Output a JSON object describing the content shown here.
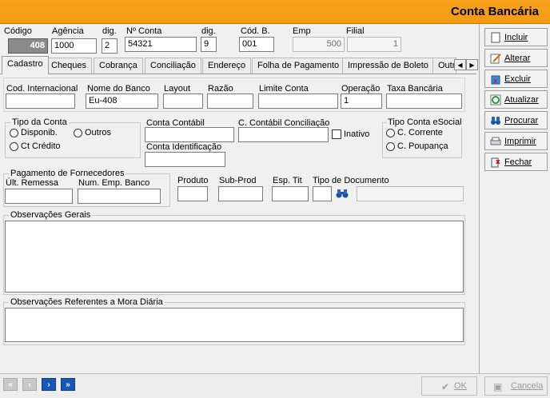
{
  "window": {
    "title": "Conta Bancária"
  },
  "header": {
    "codigo_label": "Código",
    "codigo_value": "408",
    "agencia_label": "Agência",
    "agencia_value": "1000",
    "dig1_label": "dig.",
    "dig1_value": "2",
    "conta_label": "Nº Conta",
    "conta_value": "54321",
    "dig2_label": "dig.",
    "dig2_value": "9",
    "codb_label": "Cód. B.",
    "codb_value": "001",
    "emp_label": "Emp",
    "emp_value": "500",
    "filial_label": "Filial",
    "filial_value": "1"
  },
  "tabs": [
    "Cadastro",
    "Cheques",
    "Cobrança",
    "Conciliação",
    "Endereço",
    "Folha de Pagamento",
    "Impressão de Boleto",
    "Outr"
  ],
  "cadastro": {
    "cod_intl_label": "Cod. Internacional",
    "cod_intl_value": "",
    "nome_banco_label": "Nome do Banco",
    "nome_banco_value": "Eu-408",
    "layout_label": "Layout",
    "layout_value": "",
    "razao_label": "Razão",
    "razao_value": "",
    "limite_label": "Limite Conta",
    "limite_value": "",
    "operacao_label": "Operação",
    "operacao_value": "1",
    "taxa_label": "Taxa Bancária",
    "taxa_value": ""
  },
  "tipo_conta": {
    "legend": "Tipo da Conta",
    "opt_disponib": "Disponib.",
    "opt_outros": "Outros",
    "opt_credito": "Ct Crédito"
  },
  "contabil": {
    "conta_contabil_label": "Conta Contábil",
    "conciliacao_label": "C. Contábil Conciliação",
    "inativo_label": "Inativo",
    "identificacao_label": "Conta Identificação"
  },
  "esocial": {
    "legend": "Tipo Conta eSocial",
    "opt_corrente": "C. Corrente",
    "opt_poupanca": "C. Poupança"
  },
  "fornecedores": {
    "legend": "Pagamento de Fornecedores",
    "ult_remessa_label": "Últ. Remessa",
    "num_emp_label": "Num. Emp. Banco"
  },
  "produto": {
    "produto_label": "Produto",
    "subprod_label": "Sub-Prod",
    "esp_tit_label": "Esp. Tit",
    "tipo_doc_label": "Tipo de Documento"
  },
  "obs": {
    "gerais_label": "Observações Gerais",
    "mora_label": "Observações Referentes a Mora Diária"
  },
  "sidebar": {
    "incluir": "Incluir",
    "alterar": "Alterar",
    "excluir": "Excluir",
    "atualizar": "Atualizar",
    "procurar": "Procurar",
    "imprimir": "Imprimir",
    "fechar": "Fechar"
  },
  "footer": {
    "ok": "OK",
    "cancela": "Cancela"
  },
  "colors": {
    "titlebar": "#f29a10",
    "nav_active": "#1757b7",
    "nav_disabled": "#c8c8c8"
  },
  "icons": [
    "binoculars-icon",
    "first-record-icon",
    "previous-record-icon",
    "next-record-icon",
    "last-record-icon"
  ]
}
